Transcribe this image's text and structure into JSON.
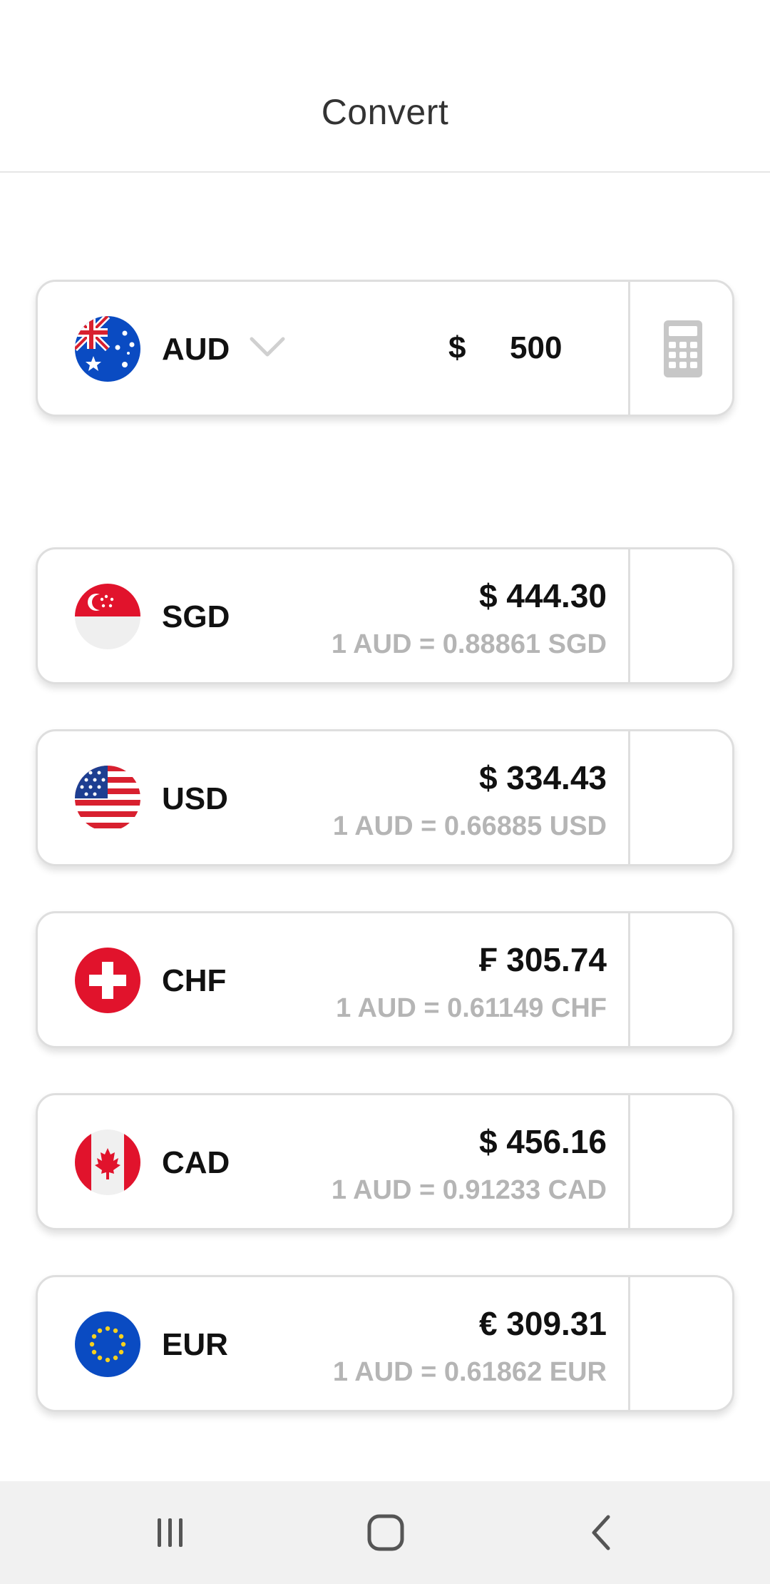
{
  "header": {
    "title": "Convert"
  },
  "source": {
    "code": "AUD",
    "flag_icon": "australia-flag-icon",
    "symbol": "$",
    "value": "500"
  },
  "targets": [
    {
      "code": "SGD",
      "flag_icon": "singapore-flag-icon",
      "amount": "$ 444.30",
      "rate": "1 AUD = 0.88861 SGD"
    },
    {
      "code": "USD",
      "flag_icon": "usa-flag-icon",
      "amount": "$ 334.43",
      "rate": "1 AUD = 0.66885 USD"
    },
    {
      "code": "CHF",
      "flag_icon": "switzerland-flag-icon",
      "amount": "₣ 305.74",
      "rate": "1 AUD = 0.61149 CHF"
    },
    {
      "code": "CAD",
      "flag_icon": "canada-flag-icon",
      "amount": "$ 456.16",
      "rate": "1 AUD = 0.91233 CAD"
    },
    {
      "code": "EUR",
      "flag_icon": "eu-flag-icon",
      "amount": "€ 309.31",
      "rate": "1 AUD = 0.61862 EUR"
    }
  ],
  "navbar": {
    "items": [
      "recent-apps-icon",
      "home-icon",
      "back-icon"
    ]
  },
  "colors": {
    "border": "#dedede",
    "rate_text": "#b5b5b5",
    "navbar_bg": "#f1f1f1"
  }
}
